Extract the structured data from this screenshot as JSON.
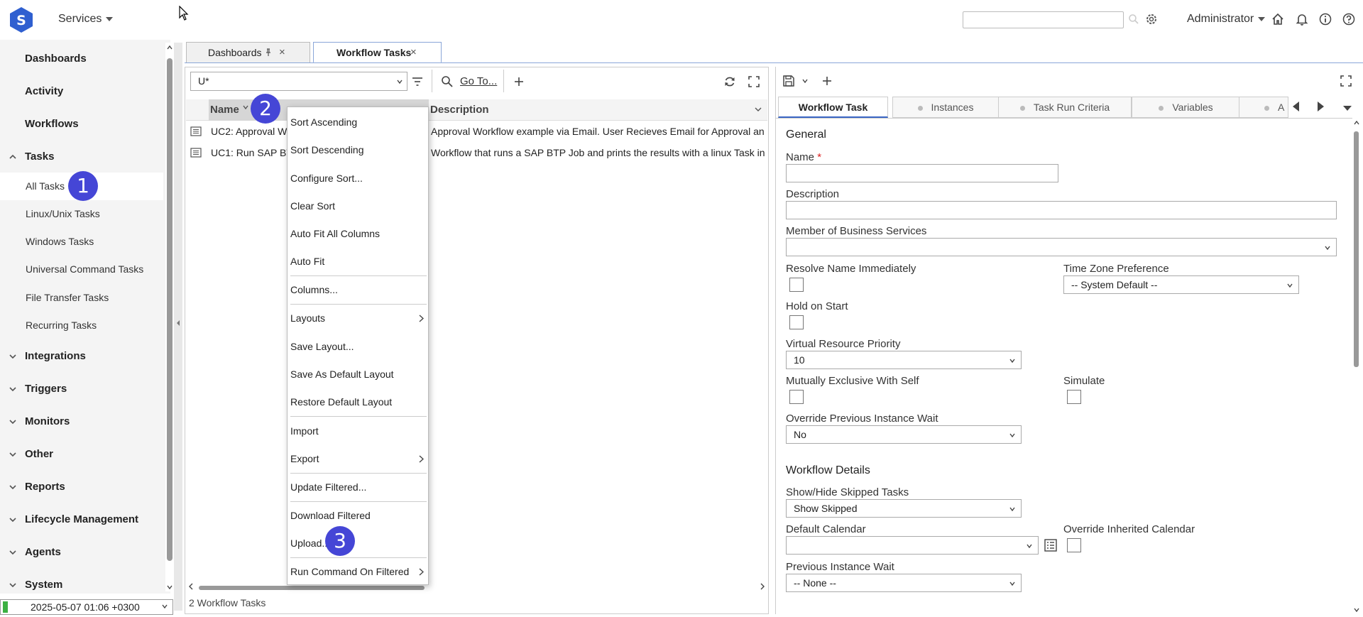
{
  "header": {
    "services_label": "Services",
    "user_label": "Administrator",
    "brand_color": "#2f5fd0"
  },
  "sidebar": {
    "items": [
      {
        "label": "Dashboards"
      },
      {
        "label": "Activity"
      },
      {
        "label": "Workflows"
      },
      {
        "label": "Tasks"
      },
      {
        "label": "Integrations"
      },
      {
        "label": "Triggers"
      },
      {
        "label": "Monitors"
      },
      {
        "label": "Other"
      },
      {
        "label": "Reports"
      },
      {
        "label": "Lifecycle Management"
      },
      {
        "label": "Agents"
      },
      {
        "label": "System"
      }
    ],
    "task_children": [
      {
        "label": "All Tasks"
      },
      {
        "label": "Linux/Unix Tasks"
      },
      {
        "label": "Windows Tasks"
      },
      {
        "label": "Universal Command Tasks"
      },
      {
        "label": "File Transfer Tasks"
      },
      {
        "label": "Recurring Tasks"
      }
    ],
    "timestamp": "2025-05-07 01:06 +0300"
  },
  "tabs": [
    {
      "label": "Dashboards"
    },
    {
      "label": "Workflow Tasks"
    }
  ],
  "list": {
    "filter_value": "U*",
    "goto_label": "Go To...",
    "columns": {
      "name": "Name",
      "description": "Description"
    },
    "rows": [
      {
        "name": "UC2: Approval W",
        "description": "Approval Workflow example via Email. User Recieves Email for Approval an"
      },
      {
        "name": "UC1: Run SAP BT",
        "description": "Workflow that runs a SAP BTP Job and prints the results with a linux Task in"
      }
    ],
    "count_label": "2 Workflow Tasks"
  },
  "context_menu": {
    "items": [
      "Sort Ascending",
      "Sort Descending",
      "Configure Sort...",
      "Clear Sort",
      "Auto Fit All Columns",
      "Auto Fit",
      "Columns...",
      "Layouts",
      "Save Layout...",
      "Save As Default Layout",
      "Restore Default Layout",
      "Import",
      "Export",
      "Update Filtered...",
      "Download Filtered",
      "Upload...",
      "Run Command On Filtered"
    ]
  },
  "badges": [
    "1",
    "2",
    "3"
  ],
  "detail_tabs": [
    {
      "label": "Workflow Task"
    },
    {
      "label": "Instances"
    },
    {
      "label": "Task Run Criteria"
    },
    {
      "label": "Variables"
    },
    {
      "label": "A"
    }
  ],
  "form": {
    "general_title": "General",
    "name_label": "Name",
    "required_mark": "*",
    "description_label": "Description",
    "business_services_label": "Member of Business Services",
    "resolve_name_label": "Resolve Name Immediately",
    "timezone_label": "Time Zone Preference",
    "timezone_value": "-- System Default --",
    "hold_on_start_label": "Hold on Start",
    "vr_priority_label": "Virtual Resource Priority",
    "vr_priority_value": "10",
    "mutually_exclusive_label": "Mutually Exclusive With Self",
    "simulate_label": "Simulate",
    "override_prev_label": "Override Previous Instance Wait",
    "override_prev_value": "No",
    "workflow_details_title": "Workflow Details",
    "show_hide_label": "Show/Hide Skipped Tasks",
    "show_hide_value": "Show Skipped",
    "default_calendar_label": "Default Calendar",
    "override_calendar_label": "Override Inherited Calendar",
    "prev_instance_wait_label": "Previous Instance Wait",
    "prev_instance_wait_value": "-- None --"
  }
}
